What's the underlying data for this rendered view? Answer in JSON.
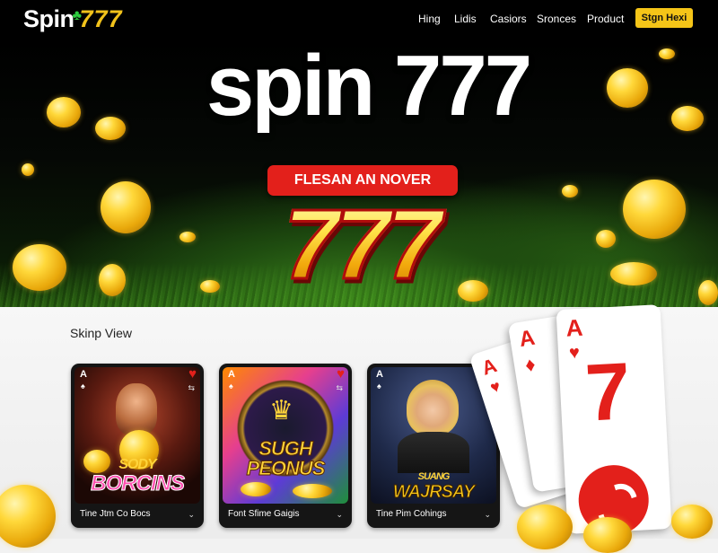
{
  "header": {
    "logo_word": "Spin",
    "logo_digits": "777",
    "nav": [
      "Hing",
      "Lidis",
      "Casiors",
      "Sronces",
      "Product"
    ],
    "signup_label": "Stgn Hexi"
  },
  "hero": {
    "title": "spin 777",
    "pill_label": "FLESAN AN NOVER",
    "big_number": "777"
  },
  "section": {
    "title": "Skinp View"
  },
  "cards": [
    {
      "art_line1": "SODY",
      "art_line2": "BORCINS",
      "caption": "Tine Jtm Co Bocs"
    },
    {
      "art_line1": "SUGH",
      "art_line2": "PEONUS",
      "caption": "Font Sfime Gaigis"
    },
    {
      "art_line1": "SUANG",
      "art_line2": "WAJRSAY",
      "caption": "Tine Pim Cohings"
    }
  ],
  "playing_cards": {
    "rank_a": "A",
    "rank_seven": "7"
  },
  "colors": {
    "brand_yellow": "#f5c518",
    "accent_red": "#e3201b",
    "header_bg": "#000000"
  }
}
